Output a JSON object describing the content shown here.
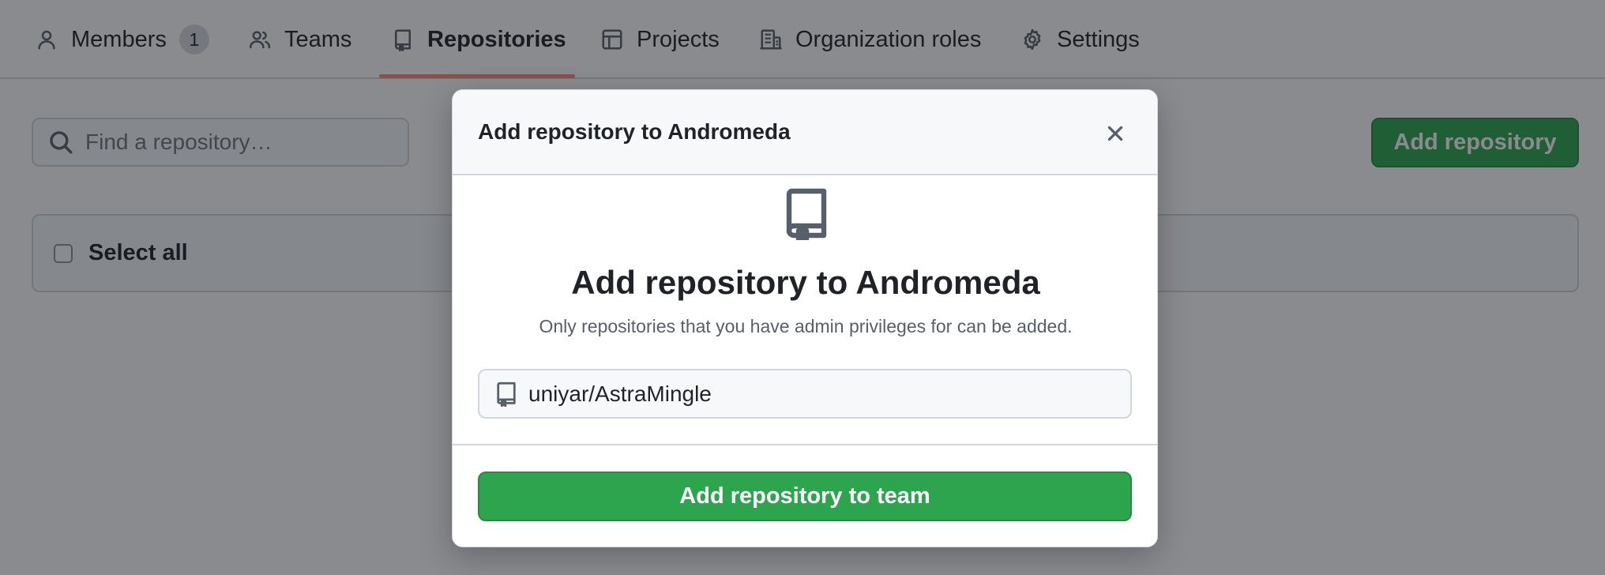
{
  "tabs": [
    {
      "label": "Members",
      "icon": "person-icon",
      "count": "1"
    },
    {
      "label": "Teams",
      "icon": "people-icon"
    },
    {
      "label": "Repositories",
      "icon": "repo-icon",
      "active": true
    },
    {
      "label": "Projects",
      "icon": "table-icon"
    },
    {
      "label": "Organization roles",
      "icon": "organization-icon"
    },
    {
      "label": "Settings",
      "icon": "gear-icon"
    }
  ],
  "search": {
    "placeholder": "Find a repository…",
    "value": ""
  },
  "toolbar": {
    "add_repository_label": "Add repository"
  },
  "list": {
    "select_all_label": "Select all"
  },
  "dialog": {
    "header_title": "Add repository to Andromeda",
    "title_prefix": "Add repository to ",
    "team_name": "Andromeda",
    "subtitle": "Only repositories that you have admin privileges for can be added.",
    "repo_input_value": "uniyar/AstraMingle",
    "submit_label": "Add repository to team"
  },
  "colors": {
    "primary_button": "#2da44e",
    "active_tab_underline": "#fd8c73",
    "overlay": "rgba(20,24,30,0.5)"
  }
}
